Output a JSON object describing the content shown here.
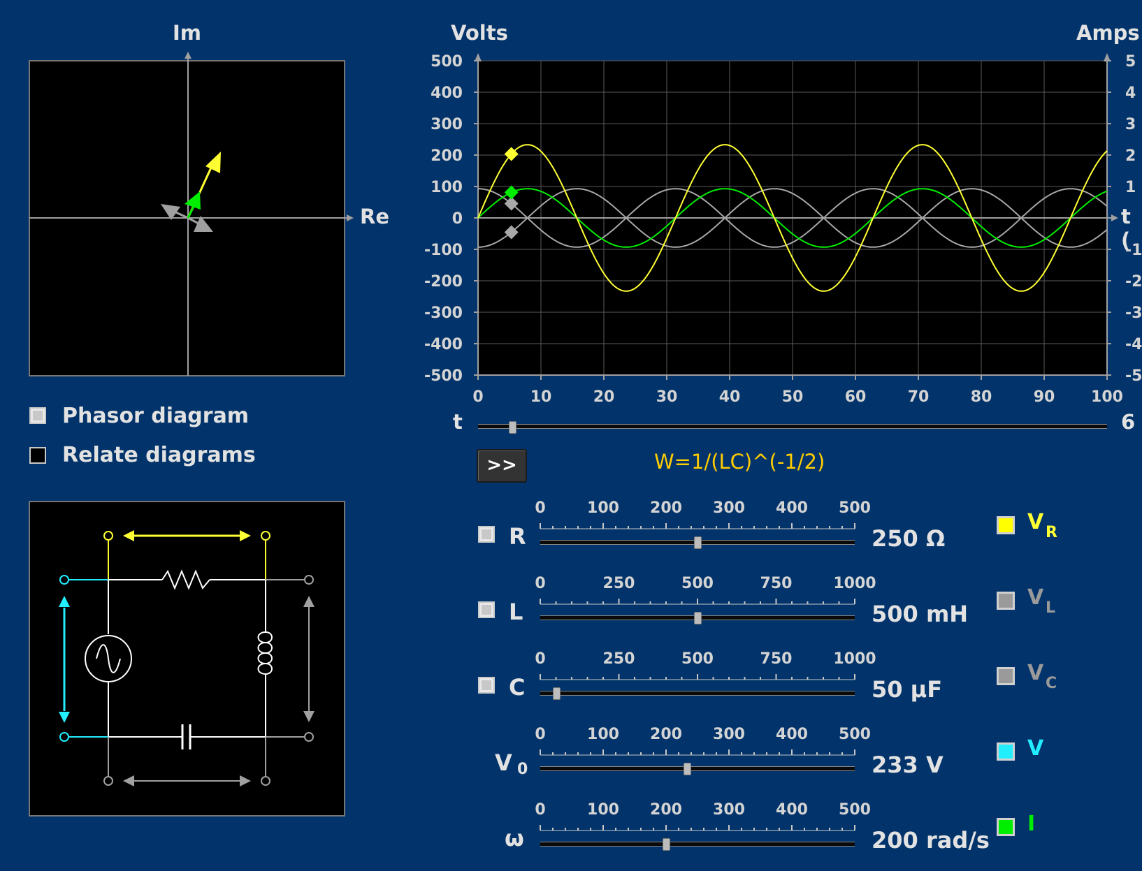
{
  "phasor": {
    "im_label": "Im",
    "re_label": "Re"
  },
  "options": {
    "phasor_label": "Phasor diagram",
    "relate_label": "Relate diagrams"
  },
  "plot": {
    "left_axis_title": "Volts",
    "right_axis_title": "Amps",
    "x_axis_title": "t (",
    "t_label": "t",
    "t_value": "6",
    "left_ticks": [
      "500",
      "400",
      "300",
      "200",
      "100",
      "0",
      "-100",
      "-200",
      "-300",
      "-400",
      "-500"
    ],
    "right_ticks": [
      "5",
      "4",
      "3",
      "2",
      "1",
      "",
      "-1",
      "-2",
      "-3",
      "-4",
      "-5"
    ],
    "x_ticks": [
      "0",
      "10",
      "20",
      "30",
      "40",
      "50",
      "60",
      "70",
      "80",
      "90",
      "100"
    ]
  },
  "formula": "W=1/(LC)^(-1/2)",
  "play_label": ">>",
  "params": [
    {
      "name": "R",
      "sub": "",
      "ticks": [
        "0",
        "100",
        "200",
        "300",
        "400",
        "500"
      ],
      "value": "250 Ω",
      "fraction": 0.5,
      "checked": true,
      "has_checkbox": true
    },
    {
      "name": "L",
      "sub": "",
      "ticks": [
        "0",
        "250",
        "500",
        "750",
        "1000"
      ],
      "value": "500 mH",
      "fraction": 0.5,
      "checked": true,
      "has_checkbox": true
    },
    {
      "name": "C",
      "sub": "",
      "ticks": [
        "0",
        "250",
        "500",
        "750",
        "1000"
      ],
      "value": "50 μF",
      "fraction": 0.05,
      "checked": true,
      "has_checkbox": true
    },
    {
      "name": "V",
      "sub": "0",
      "ticks": [
        "0",
        "100",
        "200",
        "300",
        "400",
        "500"
      ],
      "value": "233 V",
      "fraction": 0.466,
      "checked": false,
      "has_checkbox": false
    },
    {
      "name": "ω",
      "sub": "",
      "ticks": [
        "0",
        "100",
        "200",
        "300",
        "400",
        "500"
      ],
      "value": "200 rad/s",
      "fraction": 0.4,
      "checked": false,
      "has_checkbox": false
    }
  ],
  "legend": [
    {
      "label": "V",
      "sub": "R",
      "color": "#ffff00",
      "text_color": "#ffff33",
      "checked": true
    },
    {
      "label": "V",
      "sub": "L",
      "color": "#9a9a9a",
      "text_color": "#9a9a9a",
      "checked": false
    },
    {
      "label": "V",
      "sub": "C",
      "color": "#9a9a9a",
      "text_color": "#9a9a9a",
      "checked": false
    },
    {
      "label": "V",
      "sub": "",
      "color": "#22eeff",
      "text_color": "#22eeff",
      "checked": true
    },
    {
      "label": "I",
      "sub": "",
      "color": "#00ee00",
      "text_color": "#00ee00",
      "checked": true
    }
  ],
  "chart_data": {
    "type": "line",
    "x_range": [
      0,
      100
    ],
    "y_left_range": [
      -500,
      500
    ],
    "y_right_range": [
      -5,
      5
    ],
    "grid": true,
    "series": [
      {
        "amplitude": 233,
        "axis": "volts",
        "color": "#ffff33",
        "phase_deg": 0
      },
      {
        "amplitude": 93,
        "axis": "volts",
        "color": "#a8a8a8",
        "phase_deg": 90
      },
      {
        "amplitude": 93,
        "axis": "volts",
        "color": "#a8a8a8",
        "phase_deg": -90
      },
      {
        "amplitude": 0.93,
        "axis": "amps",
        "color": "#00ee00",
        "phase_deg": 0
      }
    ],
    "period": 31.4,
    "cursor_t": 5.3
  }
}
